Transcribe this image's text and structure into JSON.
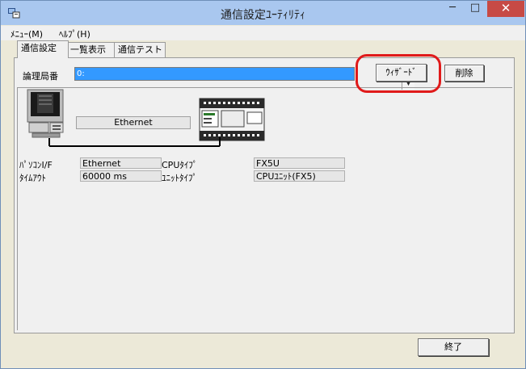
{
  "window": {
    "title": "通信設定ﾕｰﾃｨﾘﾃｨ"
  },
  "window_controls": {
    "minimize": "─",
    "maximize": "□",
    "close": "✕"
  },
  "menu": {
    "items": [
      "ﾒﾆｭｰ(M)",
      "ﾍﾙﾌﾟ(H)"
    ]
  },
  "tabs": [
    "通信設定",
    "一覧表示",
    "通信テスト"
  ],
  "station": {
    "label": "論理局番",
    "value": "0:",
    "dropdown_arrow": "▼"
  },
  "buttons": {
    "wizard": "ｳｨｻﾞｰﾄﾞ",
    "delete": "削除",
    "exit": "終了"
  },
  "connection": {
    "label": "Ethernet"
  },
  "info": {
    "pc_if_label": "ﾊﾟｿｺﾝI/F",
    "pc_if_value": "Ethernet",
    "timeout_label": "ﾀｲﾑｱｳﾄ",
    "timeout_value": "60000 ms",
    "cpu_type_label": "CPUﾀｲﾌﾟ",
    "cpu_type_value": "FX5U",
    "unit_type_label": "ﾕﾆｯﾄﾀｲﾌﾟ",
    "unit_type_value": "CPUﾕﾆｯﾄ(FX5)"
  },
  "icons": {
    "app": "app-icon",
    "pc": "pc-icon",
    "plc": "plc-icon"
  },
  "colors": {
    "titlebar": "#a9c7ef",
    "selection": "#3399ff",
    "highlight": "#e01a1a",
    "close": "#c74a45"
  }
}
